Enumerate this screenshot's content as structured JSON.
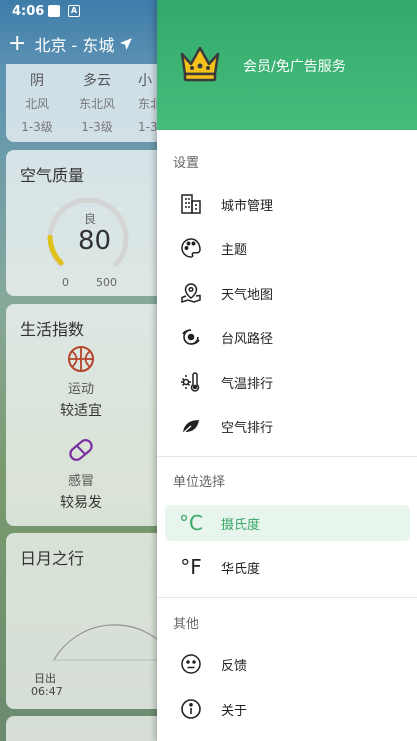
{
  "status_bar": {
    "time": "4:06",
    "notif_letter": "A"
  },
  "background": {
    "location": "北京 - 东城",
    "forecast": [
      {
        "weather": "阴",
        "wind_dir": "北风",
        "wind_level": "1-3级"
      },
      {
        "weather": "多云",
        "wind_dir": "东北风",
        "wind_level": "1-3级"
      },
      {
        "weather": "小",
        "wind_dir": "东北",
        "wind_level": "1-3"
      }
    ],
    "aqi": {
      "title": "空气质量",
      "level": "良",
      "value": "80",
      "min": "0",
      "max": "500",
      "fraction": 0.16
    },
    "life": {
      "title": "生活指数",
      "items": [
        {
          "label": "运动",
          "value": "较适宜"
        },
        {
          "label": "感冒",
          "value": "较易发"
        }
      ]
    },
    "sun": {
      "title": "日月之行",
      "sunrise_label": "日出",
      "sunrise_time": "06:47"
    }
  },
  "drawer": {
    "vip": {
      "label": "会员/免广告服务"
    },
    "sections": {
      "settings": "设置",
      "units": "单位选择",
      "other": "其他"
    },
    "settings_items": [
      {
        "label": "城市管理",
        "icon": "building-icon"
      },
      {
        "label": "主题",
        "icon": "palette-icon"
      },
      {
        "label": "天气地图",
        "icon": "map-pin-icon"
      },
      {
        "label": "台风路径",
        "icon": "typhoon-icon"
      },
      {
        "label": "气温排行",
        "icon": "thermometer-icon"
      },
      {
        "label": "空气排行",
        "icon": "leaf-icon"
      }
    ],
    "unit_items": [
      {
        "label": "摄氏度",
        "glyph": "°C",
        "selected": true
      },
      {
        "label": "华氏度",
        "glyph": "°F",
        "selected": false
      }
    ],
    "other_items": [
      {
        "label": "反馈",
        "icon": "feedback-face-icon"
      },
      {
        "label": "关于",
        "icon": "info-icon"
      }
    ]
  },
  "colors": {
    "accent": "#3aa86a",
    "header_green": "#34a96d",
    "selected_bg": "#e8f5ec"
  }
}
